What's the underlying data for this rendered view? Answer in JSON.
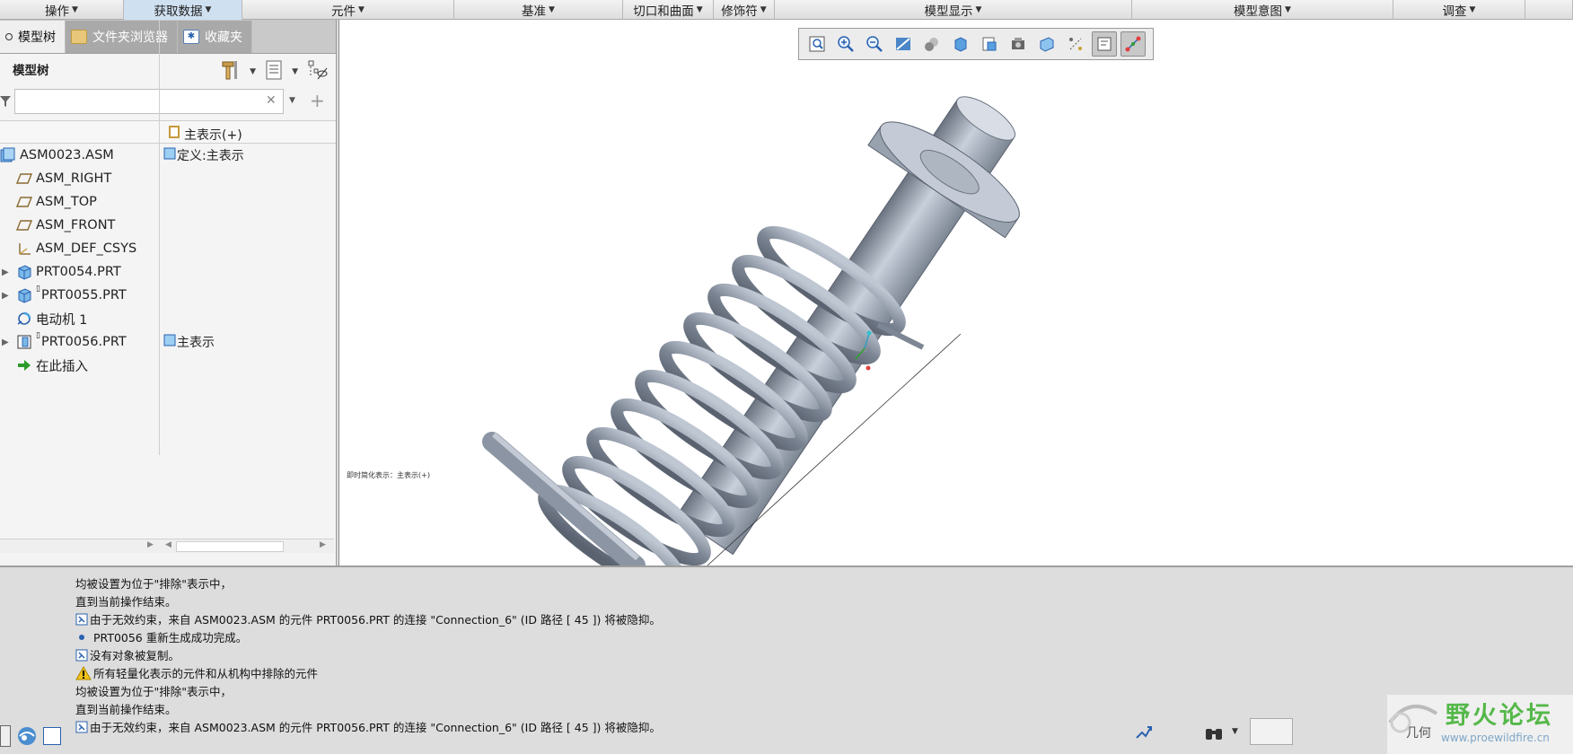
{
  "ribbon": {
    "groups": [
      {
        "label": "操作",
        "width": 138
      },
      {
        "label": "获取数据",
        "width": 132,
        "active": true
      },
      {
        "label": "元件",
        "width": 236
      },
      {
        "label": "基准",
        "width": 188
      },
      {
        "label": "切口和曲面",
        "width": 101
      },
      {
        "label": "修饰符",
        "width": 68
      },
      {
        "label": "模型显示",
        "width": 398
      },
      {
        "label": "模型意图",
        "width": 291
      },
      {
        "label": "调查",
        "width": 147
      },
      {
        "label": "",
        "width": 53
      }
    ]
  },
  "left_panel": {
    "tabs": [
      {
        "label": "模型树",
        "active": true
      },
      {
        "label": "文件夹浏览器"
      },
      {
        "label": "收藏夹"
      }
    ],
    "title": "模型树",
    "search": {
      "value": "",
      "placeholder": ""
    },
    "column_header": "主表示(+)",
    "tree": [
      {
        "label": "ASM0023.ASM",
        "icon": "assembly-icon",
        "expand": "",
        "col2": "定义:主表示",
        "col2_icon": true
      },
      {
        "label": "ASM_RIGHT",
        "icon": "datum-plane-icon",
        "expand": "",
        "col2": ""
      },
      {
        "label": "ASM_TOP",
        "icon": "datum-plane-icon",
        "expand": "",
        "col2": ""
      },
      {
        "label": "ASM_FRONT",
        "icon": "datum-plane-icon",
        "expand": "",
        "col2": ""
      },
      {
        "label": "ASM_DEF_CSYS",
        "icon": "csys-icon",
        "expand": "",
        "col2": ""
      },
      {
        "label": "PRT0054.PRT",
        "icon": "part-icon",
        "expand": "▶",
        "col2": ""
      },
      {
        "label": "PRT0055.PRT",
        "icon": "part-icon",
        "expand": "▶",
        "col2": "",
        "mark": "▯"
      },
      {
        "label": "电动机 1",
        "icon": "motor-icon",
        "expand": "",
        "col2": ""
      },
      {
        "label": "PRT0056.PRT",
        "icon": "part-excluded-icon",
        "expand": "▶",
        "col2": "主表示",
        "col2_icon": true,
        "mark": "▯"
      },
      {
        "label": "在此插入",
        "icon": "insert-here-icon",
        "expand": "",
        "col2": ""
      }
    ]
  },
  "viewport": {
    "simplified_rep_label": "即时简化表示：主表示(+)"
  },
  "messages": [
    {
      "text": "均被设置为位于\"排除\"表示中，",
      "icon": ""
    },
    {
      "text": "直到当前操作结束。",
      "icon": ""
    },
    {
      "text": "由于无效约束，来自 ASM0023.ASM 的元件 PRT0056.PRT 的连接 \"Connection_6\" (ID 路径 [ 45 ]) 将被隐抑。",
      "icon": "info-icon"
    },
    {
      "text": "PRT0056 重新生成成功完成。",
      "icon": "bullet-icon"
    },
    {
      "text": "没有对象被复制。",
      "icon": "info-icon"
    },
    {
      "text": "所有轻量化表示的元件和从机构中排除的元件",
      "icon": "warning-icon"
    },
    {
      "text": "均被设置为位于\"排除\"表示中，",
      "icon": ""
    },
    {
      "text": "直到当前操作结束。",
      "icon": ""
    },
    {
      "text": "由于无效约束，来自 ASM0023.ASM 的元件 PRT0056.PRT 的连接 \"Connection_6\" (ID 路径 [ 45 ]) 将被隐抑。",
      "icon": "info-icon"
    }
  ],
  "watermark": {
    "title": "野火论坛",
    "url": "www.proewildfire.cn",
    "corner_text": "几何"
  },
  "colors": {
    "ribbon_active": "#cfe0f1",
    "tab_inactive": "#a9a9a9",
    "model_gray": "#8c95a3",
    "watermark_green": "#55b84a"
  }
}
